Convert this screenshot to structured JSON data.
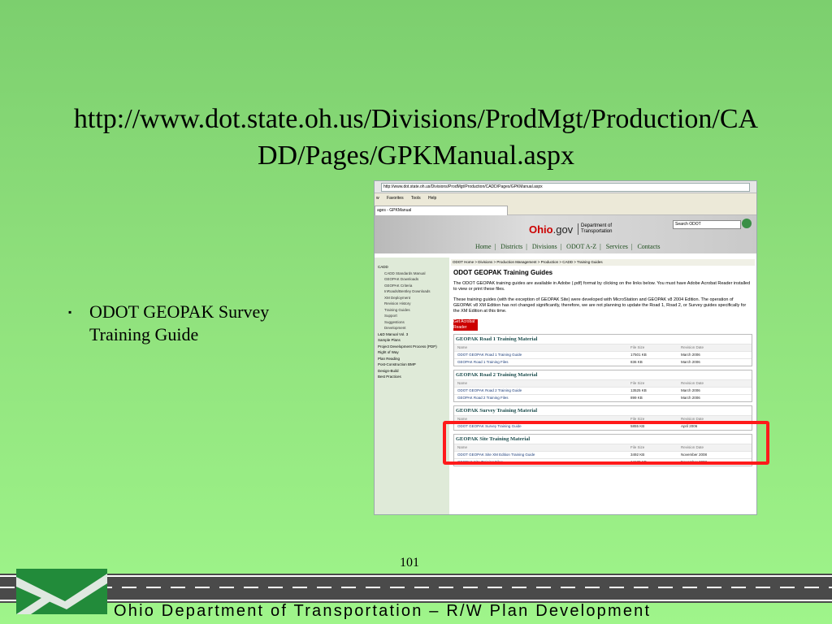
{
  "slide": {
    "title_line1": "http://www.dot.state.oh.us/Divisions/ProdMgt/Production/CA",
    "title_line2": "DD/Pages/GPKManual.aspx",
    "bullet_line1": "ODOT GEOPAK Survey",
    "bullet_line2": "Training Guide",
    "bullet_mark": "▪",
    "page_number": "101",
    "footer": "Ohio Department of Transportation – R/W Plan Development"
  },
  "browser": {
    "address": "http://www.dot.state.oh.us/Divisions/ProdMgt/Production/CADD/Pages/GPKManual.aspx",
    "menu": [
      "w",
      "Favorites",
      "Tools",
      "Help"
    ],
    "tab": "ages - GPKManual"
  },
  "site": {
    "ohio": "Ohio",
    "gov": ".gov",
    "dept_line1": "Department of",
    "dept_line2": "Transportation",
    "search_placeholder": "Search ODOT",
    "nav": [
      "Home",
      "Districts",
      "Divisions",
      "ODOT A-Z",
      "Services",
      "Contacts"
    ]
  },
  "sidebar": [
    {
      "label": "CADD",
      "sub": false
    },
    {
      "label": "CADD Standards Manual",
      "sub": true
    },
    {
      "label": "GEOPAK Downloads",
      "sub": true
    },
    {
      "label": "GEOPAK Criteria",
      "sub": true
    },
    {
      "label": "InRoads/Bentley Downloads",
      "sub": true
    },
    {
      "label": "XM Deployment",
      "sub": true
    },
    {
      "label": "Revision History",
      "sub": true
    },
    {
      "label": "Training Guides",
      "sub": true
    },
    {
      "label": "Support",
      "sub": true
    },
    {
      "label": "Suggestions",
      "sub": true
    },
    {
      "label": "Development",
      "sub": true
    },
    {
      "label": "L&D Manual Vol. 3",
      "sub": false
    },
    {
      "label": "Sample Plans",
      "sub": false
    },
    {
      "label": "Project Development Process (PDP)",
      "sub": false
    },
    {
      "label": "Right of Way",
      "sub": false
    },
    {
      "label": "Plan Reading",
      "sub": false
    },
    {
      "label": "Post-Construction BMP",
      "sub": false
    },
    {
      "label": "Design-Build",
      "sub": false
    },
    {
      "label": "Best Practices",
      "sub": false
    }
  ],
  "main": {
    "breadcrumb": "ODOT Home > Divisions > Production Management > Production > CADD > Training Guides",
    "heading": "ODOT GEOPAK Training Guides",
    "para1": "The ODOT GEOPAK training guides are available in Adobe (.pdf) format by clicking on the links below. You must have Adobe Acrobat Reader installed to view or print these files.",
    "para2": "These training guides (with the exception of GEOPAK Site) were developed with MicroStation and GEOPAK v8 2004 Edition. The operation of GEOPAK v8 XM Edition has not changed significantly, therefore, we are not planning to update the Road 1, Road 2, or Survey guides specifically for the XM Edition at this time.",
    "acrobat": "Get Acrobat Reader",
    "col_name": "Name",
    "col_size": "File Size",
    "col_date": "Revision Date",
    "sections": [
      {
        "title": "GEOPAK Road 1 Training Material",
        "rows": [
          [
            "ODOT GEOPAK Road 1 Training Guide",
            "17501 KB",
            "March 2006"
          ],
          [
            "GEOPAK Road 1 Training Files",
            "836 KB",
            "March 2006"
          ]
        ]
      },
      {
        "title": "GEOPAK Road 2 Training Material",
        "rows": [
          [
            "ODOT GEOPAK Road 2 Training Guide",
            "13525 KB",
            "March 2006"
          ],
          [
            "GEOPAK Road 2 Training Files",
            "899 KB",
            "March 2006"
          ]
        ]
      },
      {
        "title": "GEOPAK Survey Training Material",
        "rows": [
          [
            "ODOT GEOPAK Survey Training Guide",
            "5855 KB",
            "April 2006"
          ]
        ]
      },
      {
        "title": "GEOPAK Site Training Material",
        "rows": [
          [
            "ODOT GEOPAK Site XM Edition Training Guide",
            "3492 KB",
            "November 2008"
          ],
          [
            "GEOPAK Site Training Files",
            "14139 KB",
            "November 2008"
          ]
        ]
      }
    ]
  }
}
